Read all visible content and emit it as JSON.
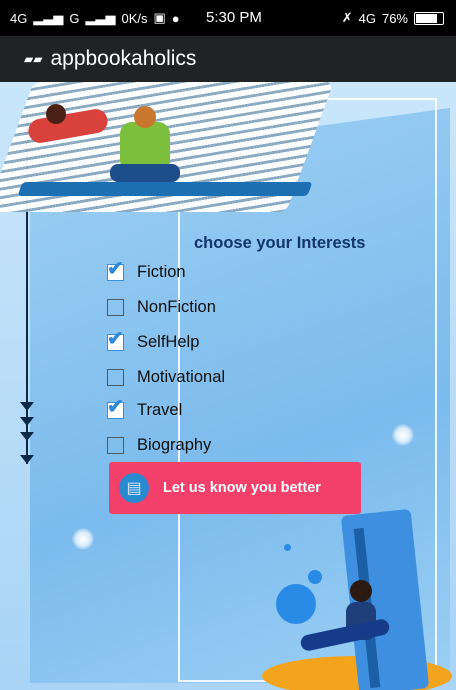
{
  "status_bar": {
    "left_text": "4G",
    "left_text_2": "G",
    "speed": "0K/s",
    "time": "5:30 PM",
    "network_right": "4G",
    "battery": "76%"
  },
  "app_bar": {
    "title": "appbookaholics",
    "icon": "book-icon"
  },
  "main": {
    "heading": "choose your Interests",
    "interests": [
      {
        "label": "Fiction",
        "checked": true
      },
      {
        "label": "NonFiction",
        "checked": false
      },
      {
        "label": "SelfHelp",
        "checked": true
      },
      {
        "label": "Motivational",
        "checked": false
      },
      {
        "label": "Travel",
        "checked": true
      },
      {
        "label": "Biography",
        "checked": false
      }
    ],
    "cta": {
      "label": "Let us know you better",
      "icon": "open-book-icon"
    }
  },
  "colors": {
    "accent": "#f2406b",
    "checkbox": "#2f89d8",
    "heading": "#12356b"
  }
}
